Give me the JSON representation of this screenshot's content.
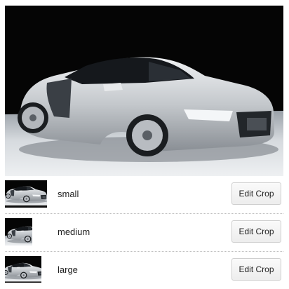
{
  "image": {
    "subject": "silver sports car",
    "colors": {
      "background": "#050505",
      "floor": "#dfe3e6",
      "body": "#c9ccd0",
      "body_shadow": "#8d9196",
      "windows": "#15181c",
      "headlight": "#f4f6f8"
    }
  },
  "crops": [
    {
      "label": "small",
      "button_label": "Edit Crop"
    },
    {
      "label": "medium",
      "button_label": "Edit Crop"
    },
    {
      "label": "large",
      "button_label": "Edit Crop"
    }
  ]
}
